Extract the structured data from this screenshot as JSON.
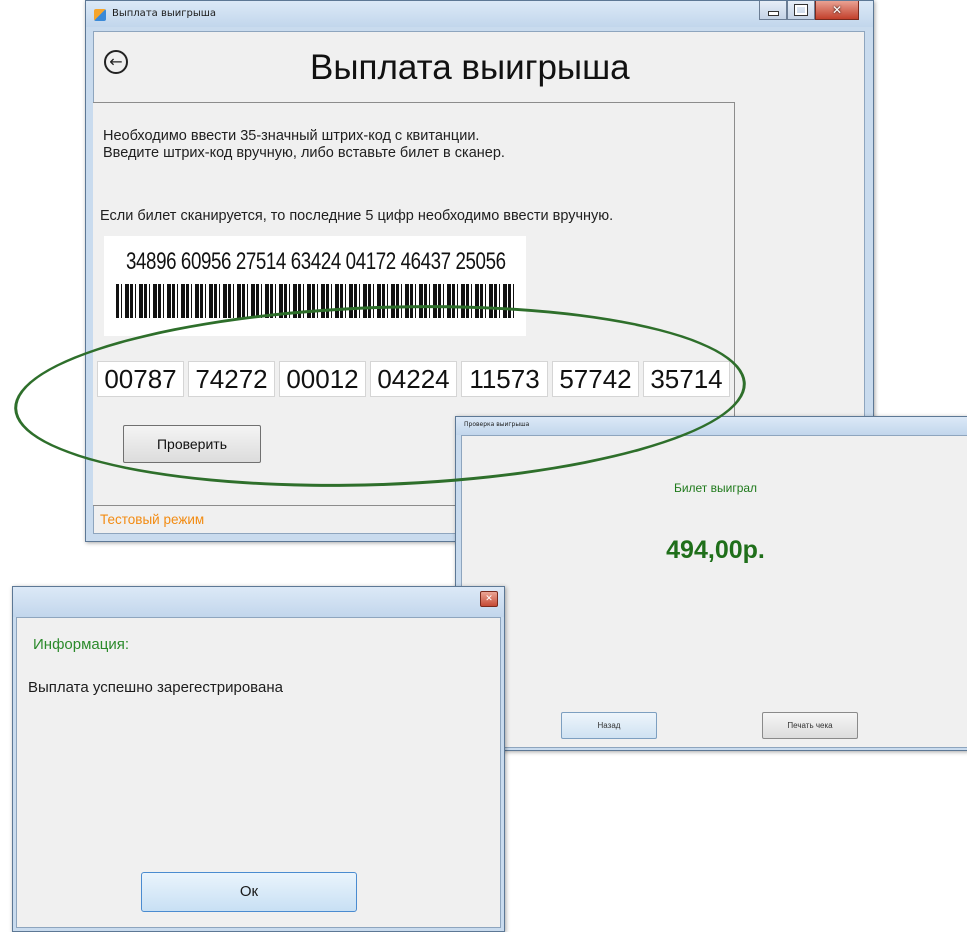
{
  "main_window": {
    "title": "Выплата выигрыша",
    "heading": "Выплата выигрыша",
    "instruction_line1": "Необходимо ввести 35-значный штрих-код с квитанции.",
    "instruction_line2": "Введите штрих-код вручную, либо вставьте билет в сканер.",
    "instruction_scan": "Если билет сканируется, то последние 5 цифр необходимо ввести вручную.",
    "barcode_printed": "34896 60956 27514 63424 04172 46437 25056",
    "code_groups": [
      "00787",
      "74272",
      "00012",
      "04224",
      "11573",
      "57742",
      "35714"
    ],
    "check_button": "Проверить",
    "status": "Тестовый режим"
  },
  "result_window": {
    "title": "Проверка выигрыша",
    "message": "Билет выиграл",
    "amount": "494,00р.",
    "back_button": "Назад",
    "print_button": "Печать чека"
  },
  "info_window": {
    "heading": "Информация:",
    "message": "Выплата успешно зарегестрирована",
    "ok_button": "Ок"
  },
  "colors": {
    "status_orange": "#f28b12",
    "success_green": "#1f6f1a",
    "annotation_green": "#2e6f2b"
  },
  "icons": {
    "back": "back-arrow-icon",
    "app": "app-icon",
    "minimize": "minimize-icon",
    "maximize": "maximize-icon",
    "close": "close-icon"
  }
}
